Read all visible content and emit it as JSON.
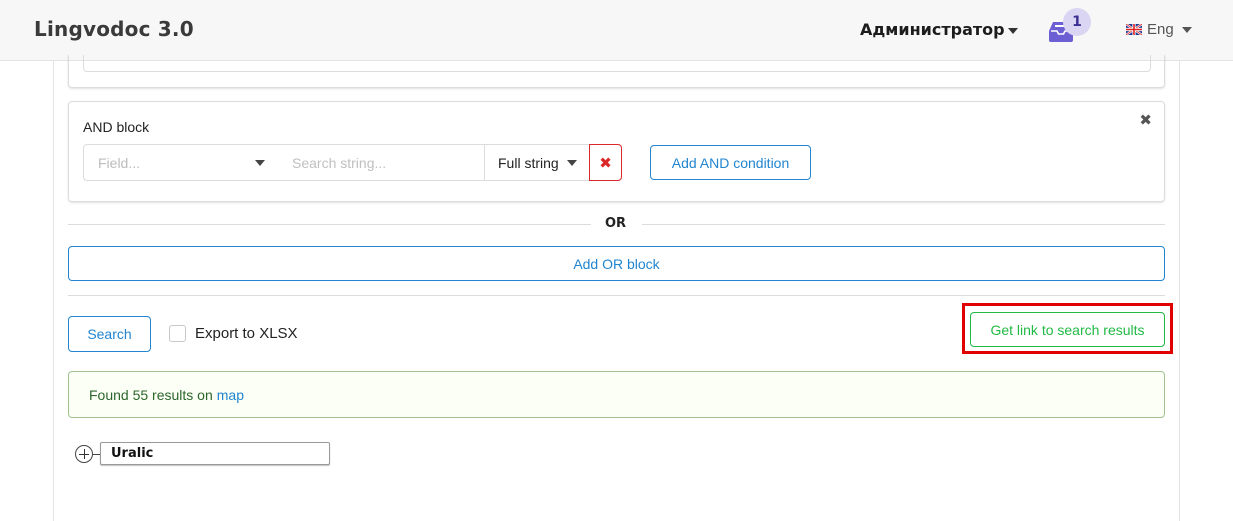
{
  "header": {
    "brand": "Lingvodoc 3.0",
    "user_menu": "Администратор",
    "tasks_count": "1",
    "language": "Eng"
  },
  "and_block": {
    "title": "AND block",
    "field_placeholder": "Field...",
    "search_placeholder": "Search string...",
    "match_mode": "Full string",
    "add_and_label": "Add AND condition"
  },
  "or_divider": "OR",
  "add_or_label": "Add OR block",
  "actions": {
    "search_label": "Search",
    "export_label": "Export to XLSX",
    "export_checked": false,
    "get_link_label": "Get link to search results"
  },
  "result": {
    "text": "Found 55 results on",
    "link": "map"
  },
  "tree": {
    "root_label": "Uralic"
  },
  "colors": {
    "primary": "#2185d0",
    "positive": "#21ba45",
    "danger": "#db2828",
    "highlight": "#e00000",
    "badge_bg": "#d9d5f3",
    "inbox_icon": "#6c5fd3"
  }
}
